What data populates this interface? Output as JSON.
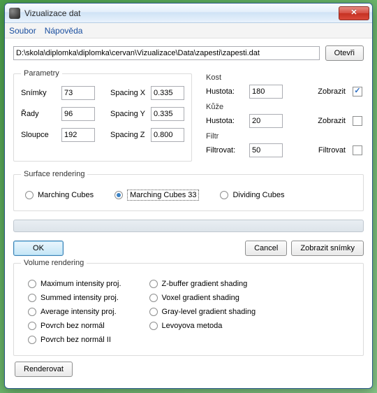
{
  "window": {
    "title": "Vizualizace dat"
  },
  "menu": {
    "soubor": "Soubor",
    "napoveda": "Nápověda"
  },
  "path": {
    "value": "D:\\skola\\diplomka\\diplomka\\cervan\\Vizualizace\\Data\\zapesti\\zapesti.dat",
    "open": "Otevři"
  },
  "params": {
    "legend": "Parametry",
    "snimky_lbl": "Snímky",
    "snimky_val": "73",
    "rady_lbl": "Řady",
    "rady_val": "96",
    "sloupce_lbl": "Sloupce",
    "sloupce_val": "192",
    "sx_lbl": "Spacing X",
    "sx_val": "0.335",
    "sy_lbl": "Spacing Y",
    "sy_val": "0.335",
    "sz_lbl": "Spacing Z",
    "sz_val": "0.800"
  },
  "kost": {
    "legend": "Kost",
    "hustota_lbl": "Hustota:",
    "hustota_val": "180",
    "zobrazit_lbl": "Zobrazit",
    "zobrazit_checked": true
  },
  "kuze": {
    "legend": "Kůže",
    "hustota_lbl": "Hustota:",
    "hustota_val": "20",
    "zobrazit_lbl": "Zobrazit",
    "zobrazit_checked": false
  },
  "filtr": {
    "legend": "Filtr",
    "filtrovat_lbl": "Filtrovat:",
    "filtrovat_val": "50",
    "cb_lbl": "Filtrovat",
    "cb_checked": false
  },
  "surface": {
    "legend": "Surface rendering",
    "opt1": "Marching Cubes",
    "opt2": "Marching Cubes 33",
    "opt3": "Dividing Cubes",
    "selected": "opt2"
  },
  "actions": {
    "ok": "OK",
    "cancel": "Cancel",
    "zobrazit_snimky": "Zobrazit snímky",
    "renderovat": "Renderovat"
  },
  "volume": {
    "legend": "Volume rendering",
    "left": [
      "Maximum intensity proj.",
      "Summed intensity proj.",
      "Average intensity proj.",
      "Povrch bez normál",
      "Povrch bez normál II"
    ],
    "right": [
      "Z-buffer gradient shading",
      "Voxel gradient shading",
      "Gray-level gradient shading",
      "Levoyova metoda"
    ]
  }
}
